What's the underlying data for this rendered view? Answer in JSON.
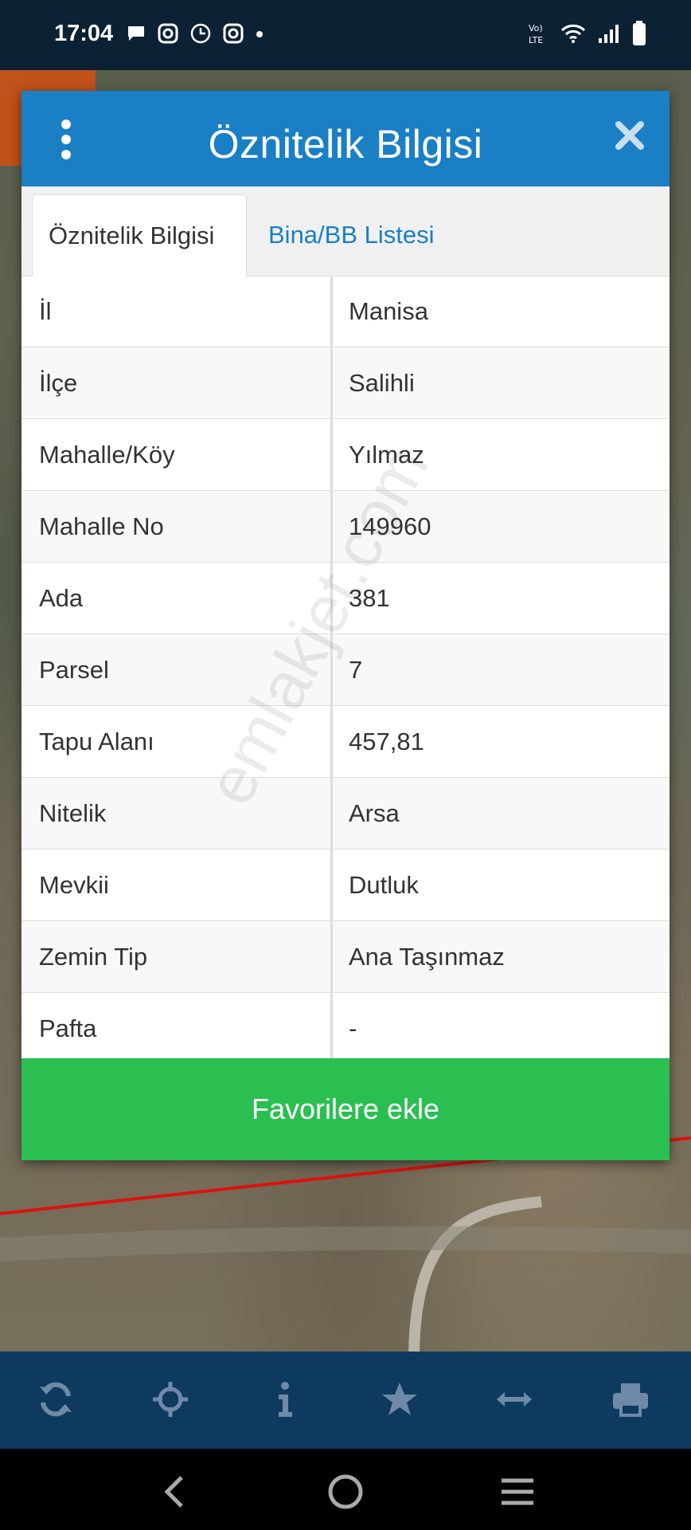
{
  "status_bar": {
    "time": "17:04"
  },
  "dialog": {
    "title": "Öznitelik Bilgisi",
    "tabs": [
      {
        "label": "Öznitelik Bilgisi",
        "active": true
      },
      {
        "label": "Bina/BB Listesi",
        "active": false
      }
    ],
    "rows": [
      {
        "key": "İl",
        "value": "Manisa"
      },
      {
        "key": "İlçe",
        "value": "Salihli"
      },
      {
        "key": "Mahalle/Köy",
        "value": "Yılmaz"
      },
      {
        "key": "Mahalle No",
        "value": "149960"
      },
      {
        "key": "Ada",
        "value": "381"
      },
      {
        "key": "Parsel",
        "value": "7"
      },
      {
        "key": "Tapu Alanı",
        "value": "457,81"
      },
      {
        "key": "Nitelik",
        "value": "Arsa"
      },
      {
        "key": "Mevkii",
        "value": "Dutluk"
      },
      {
        "key": "Zemin Tip",
        "value": "Ana Taşınmaz"
      },
      {
        "key": "Pafta",
        "value": "-"
      }
    ],
    "favorite_label": "Favorilere ekle"
  },
  "watermark": "emlakjet.com",
  "toolbar_icons": [
    "refresh-icon",
    "crosshair-icon",
    "info-icon",
    "star-icon",
    "measure-icon",
    "print-icon"
  ],
  "nav_icons": [
    "back-icon",
    "home-icon",
    "recents-icon"
  ],
  "colors": {
    "header": "#1a7fc4",
    "favorite": "#2bbf52",
    "toolbar": "#0f3a60",
    "tab_link": "#1a7fc4"
  }
}
